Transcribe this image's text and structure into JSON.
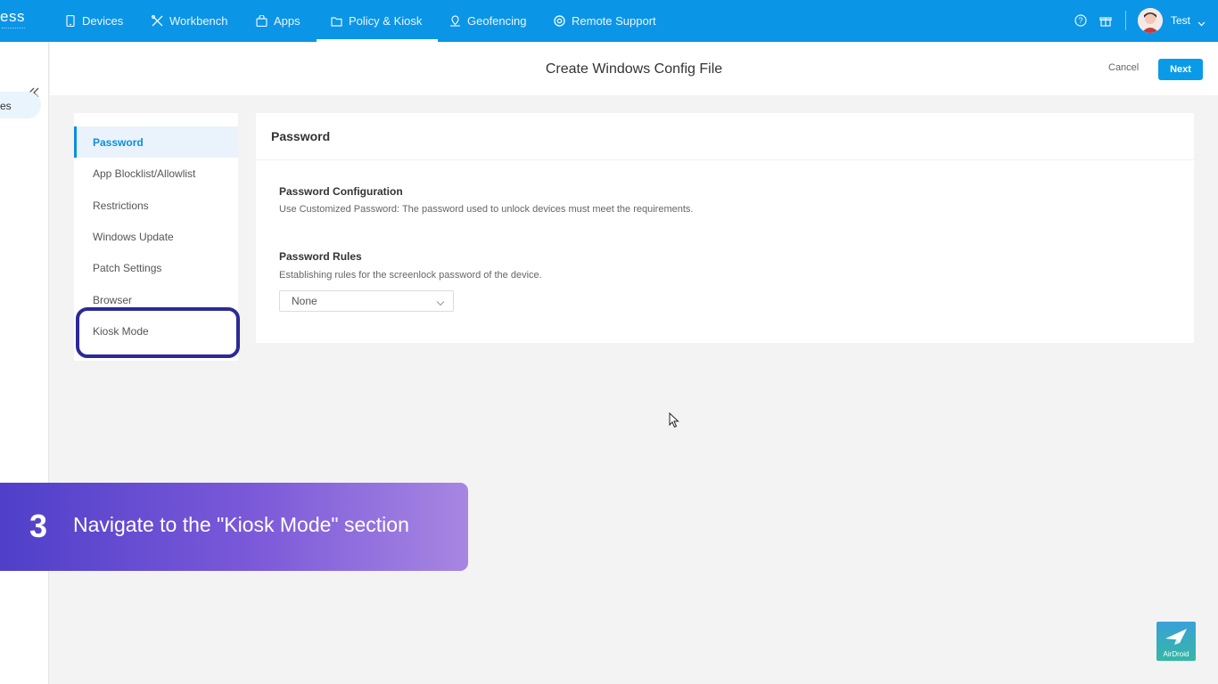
{
  "topbar": {
    "brand": "ess",
    "nav": [
      {
        "label": "Devices",
        "icon": "tablet-icon"
      },
      {
        "label": "Workbench",
        "icon": "tools-icon"
      },
      {
        "label": "Apps",
        "icon": "bag-icon"
      },
      {
        "label": "Policy & Kiosk",
        "icon": "folder-icon",
        "active": true
      },
      {
        "label": "Geofencing",
        "icon": "map-icon"
      },
      {
        "label": "Remote Support",
        "icon": "lifebuoy-icon"
      }
    ],
    "user_name": "Test"
  },
  "left_strip": {
    "item_text": "es"
  },
  "header": {
    "title": "Create Windows Config File",
    "cancel_label": "Cancel",
    "next_label": "Next"
  },
  "side_menu": {
    "items": [
      {
        "label": "Password",
        "active": true
      },
      {
        "label": "App Blocklist/Allowlist"
      },
      {
        "label": "Restrictions"
      },
      {
        "label": "Windows Update"
      },
      {
        "label": "Patch Settings"
      },
      {
        "label": "Browser"
      },
      {
        "label": "Kiosk Mode",
        "highlighted": true
      }
    ]
  },
  "content": {
    "card_title": "Password",
    "config_title": "Password Configuration",
    "config_desc": "Use Customized Password: The password used to unlock devices must meet the requirements.",
    "rules_title": "Password Rules",
    "rules_desc": "Establishing rules for the screenlock password of the device.",
    "rules_value": "None"
  },
  "caption": {
    "step": "3",
    "text": "Navigate to the \"Kiosk Mode\" section"
  },
  "watermark": {
    "text": "AirDroid"
  },
  "colors": {
    "primary": "#0b95e6",
    "highlight": "#2c2a97",
    "caption_start": "#4f3fc9",
    "caption_end": "#a786e2"
  }
}
